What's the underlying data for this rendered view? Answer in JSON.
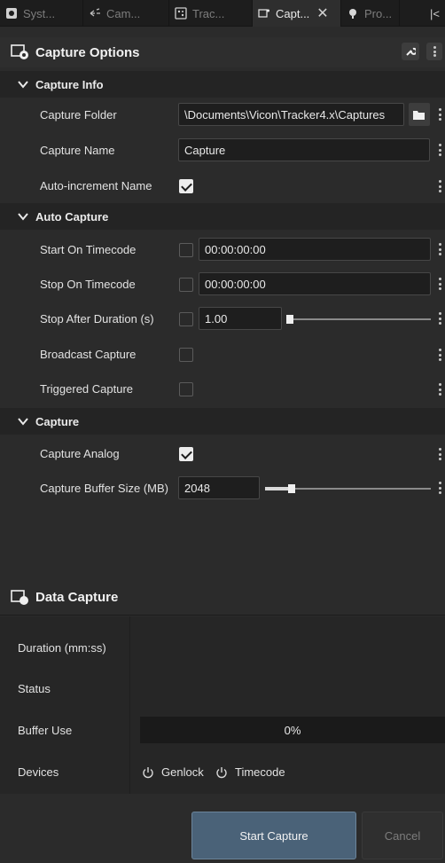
{
  "tabs": [
    {
      "label": "Syst...",
      "icon": "gear-icon",
      "active": false
    },
    {
      "label": "Cam...",
      "icon": "camera-rays-icon",
      "active": false
    },
    {
      "label": "Trac...",
      "icon": "tracking-dots-icon",
      "active": false
    },
    {
      "label": "Capt...",
      "icon": "capture-icon",
      "active": true
    },
    {
      "label": "Pro...",
      "icon": "processing-icon",
      "active": false
    }
  ],
  "panel": {
    "title": "Capture Options"
  },
  "capture_info": {
    "title": "Capture Info",
    "folder_label": "Capture Folder",
    "folder_value": "\\Documents\\Vicon\\Tracker4.x\\Captures",
    "name_label": "Capture Name",
    "name_value": "Capture",
    "autoinc_label": "Auto-increment Name",
    "autoinc_checked": true
  },
  "auto_capture": {
    "title": "Auto Capture",
    "start_label": "Start On Timecode",
    "start_value": "00:00:00:00",
    "stop_label": "Stop On Timecode",
    "stop_value": "00:00:00:00",
    "duration_label": "Stop After Duration (s)",
    "duration_value": "1.00",
    "broadcast_label": "Broadcast Capture",
    "triggered_label": "Triggered Capture"
  },
  "capture": {
    "title": "Capture",
    "analog_label": "Capture Analog",
    "analog_checked": true,
    "buffer_label": "Capture Buffer Size (MB)",
    "buffer_value": "2048"
  },
  "data_capture": {
    "title": "Data Capture",
    "duration_label": "Duration (mm:ss)",
    "status_label": "Status",
    "buffer_label": "Buffer Use",
    "buffer_value": "0%",
    "devices_label": "Devices",
    "device_genlock": "Genlock",
    "device_timecode": "Timecode"
  },
  "buttons": {
    "start": "Start Capture",
    "cancel": "Cancel"
  }
}
